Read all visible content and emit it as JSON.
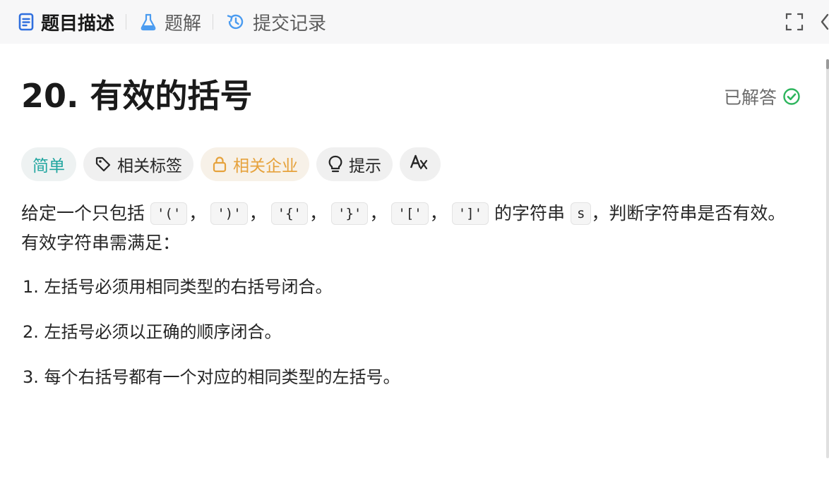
{
  "tabs": [
    {
      "label": "题目描述",
      "icon": "document-icon",
      "active": true
    },
    {
      "label": "题解",
      "icon": "flask-icon",
      "active": false
    },
    {
      "label": "提交记录",
      "icon": "history-icon",
      "active": false
    }
  ],
  "problem": {
    "title": "20. 有效的括号",
    "status": "已解答"
  },
  "tags": {
    "difficulty": "简单",
    "related_tags": "相关标签",
    "related_companies": "相关企业",
    "hint": "提示"
  },
  "description": {
    "intro_prefix": "给定一个只包括",
    "codes": [
      "'('",
      "')'",
      "'{'",
      "'}'",
      "'['",
      "']'"
    ],
    "comma": "，",
    "intro_mid": "的字符串",
    "var": "s",
    "intro_suffix": "，判断字符串是否有效。",
    "requirement_heading": "有效字符串需满足：",
    "rules": [
      "1. 左括号必须用相同类型的右括号闭合。",
      "2. 左括号必须以正确的顺序闭合。",
      "3. 每个右括号都有一个对应的相同类型的左括号。"
    ]
  },
  "colors": {
    "accent_blue": "#2f6fde",
    "easy": "#22a6a0",
    "locked": "#e6a23c",
    "solved_check": "#2db55d"
  }
}
